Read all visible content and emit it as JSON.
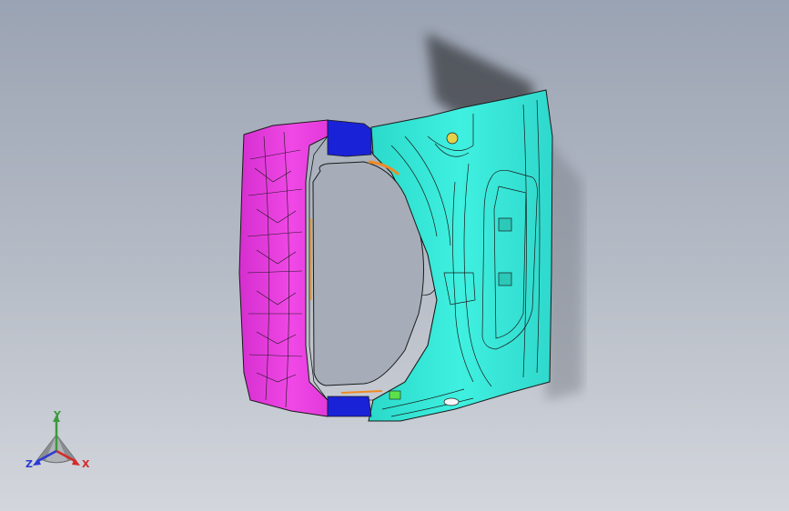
{
  "viewport": {
    "model": "tailgate-assembly",
    "colors": {
      "background_top": "#9aa3b3",
      "background_bottom": "#d3d6dc",
      "outer_panel": "#33e6d6",
      "inner_panel": "#e83bdc",
      "hinge_bracket": "#1a22d8",
      "seal_strip": "#f08a22",
      "edge_lines": "#1a1a1a",
      "shadow": "#3a3d42"
    }
  },
  "triad": {
    "x_label": "X",
    "y_label": "Y",
    "z_label": "Z",
    "colors": {
      "x": "#d42a2a",
      "y": "#3a9a3a",
      "z": "#2b3bd0"
    }
  }
}
